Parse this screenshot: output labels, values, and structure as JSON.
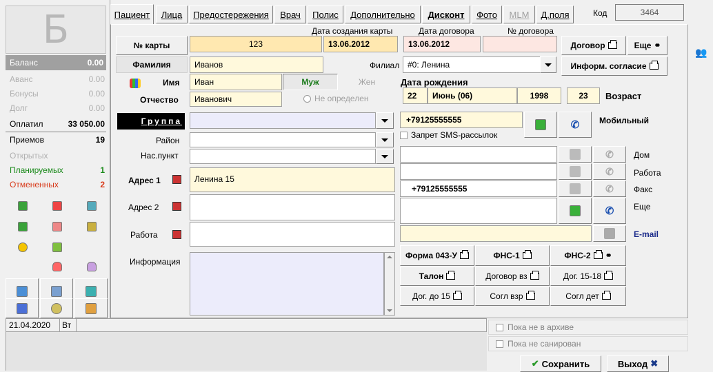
{
  "sidebar": {
    "letter": "Б",
    "balance_label": "Баланс",
    "balance_value": "0.00",
    "rows": [
      {
        "label": "Аванс",
        "value": "0.00"
      },
      {
        "label": "Бонусы",
        "value": "0.00"
      },
      {
        "label": "Долг",
        "value": "0.00"
      },
      {
        "label": "Оплатил",
        "value": "33 050.00"
      },
      {
        "label": "Приемов",
        "value": "19"
      },
      {
        "label": "Открытых",
        "value": ""
      },
      {
        "label": "Планируемых",
        "value": "1"
      },
      {
        "label": "Отмененных",
        "value": "2"
      }
    ],
    "date": "21.04.2020",
    "weekday": "Вт"
  },
  "tabs": [
    {
      "label": "Пациент"
    },
    {
      "label": "Лица"
    },
    {
      "label": "Предостережения"
    },
    {
      "label": "Врач"
    },
    {
      "label": "Полис"
    },
    {
      "label": "Дополнительно"
    },
    {
      "label": "Дисконт"
    },
    {
      "label": "Фото"
    },
    {
      "label": "MLM"
    },
    {
      "label": "Д.поля"
    }
  ],
  "code": {
    "label": "Код",
    "value": "3464"
  },
  "form": {
    "card_label": "№ карты",
    "card_value": "123",
    "created_label": "Дата создания карты",
    "created_value": "13.06.2012",
    "contract_date_label": "Дата договора",
    "contract_date_value": "13.06.2012",
    "contract_no_label": "№ договора",
    "contract_no_value": "",
    "contract_btn": "Договор",
    "more_btn": "Еще",
    "consent_btn": "Информ. согласие",
    "surname_label": "Фамилия",
    "surname_value": "Иванов",
    "branch_label": "Филиал",
    "branch_value": "#0:  Ленина",
    "name_label": "Имя",
    "name_value": "Иван",
    "male_label": "Муж",
    "female_label": "Жен",
    "patronymic_label": "Отчество",
    "patronymic_value": "Иванович",
    "undefined_label": "Не определен",
    "birth_label": "Дата рождения",
    "birth_day": "22",
    "birth_month": "Июнь (06)",
    "birth_year": "1998",
    "age_value": "23",
    "age_label": "Возраст",
    "group_label": "Группа",
    "group_value": "",
    "district_label": "Район",
    "locality_label": "Нас.пункт",
    "mobile_value": "+79125555555",
    "mobile_label": "Мобильный",
    "sms_label": "Запрет SMS-рассылок",
    "address1_label": "Адрес 1",
    "address1_value": "Ленина 15",
    "address2_label": "Адрес 2",
    "work_label": "Работа",
    "info_label": "Информация",
    "home_label": "Дом",
    "work_phone_label": "Работа",
    "fax_label": "Факс",
    "fax_value": "+79125555555",
    "more_phone_label": "Еще",
    "email_label": "E-mail"
  },
  "print_buttons": [
    {
      "label": "Форма 043-У"
    },
    {
      "label": "ФНС-1"
    },
    {
      "label": "ФНС-2"
    },
    {
      "label": "Талон"
    },
    {
      "label": "Договор вз"
    },
    {
      "label": "Дог. 15-18"
    },
    {
      "label": "Дог. до 15"
    },
    {
      "label": "Согл взр"
    },
    {
      "label": "Согл дет"
    }
  ],
  "bottom": {
    "archive_label": "Пока не в архиве",
    "sanitized_label": "Пока не санирован",
    "save_btn": "Сохранить",
    "exit_btn": "Выход"
  }
}
